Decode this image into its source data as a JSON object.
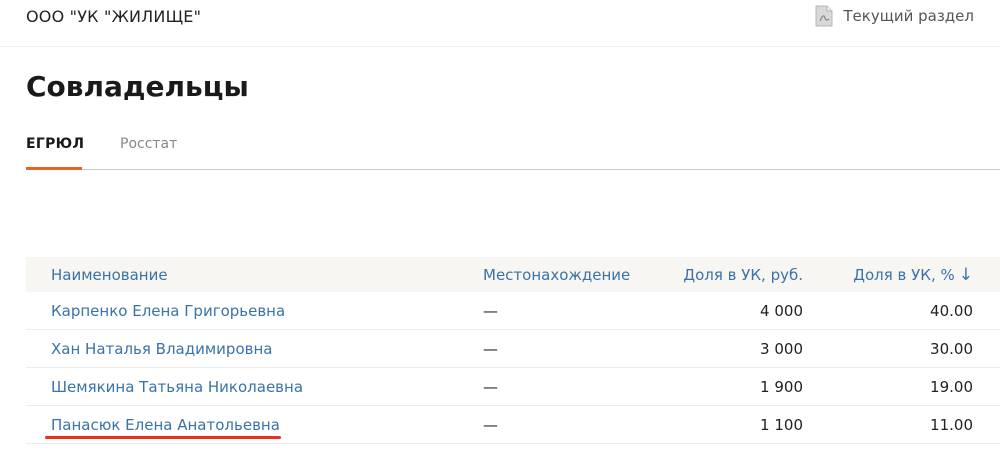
{
  "header": {
    "company": "ООО \"УК \"ЖИЛИЩЕ\"",
    "section_link": "Текущий раздел",
    "section_icon": "pdf-file-icon"
  },
  "page": {
    "title": "Совладельцы"
  },
  "tabs": [
    {
      "label": "ЕГРЮЛ",
      "active": true
    },
    {
      "label": "Росстат",
      "active": false
    }
  ],
  "table": {
    "headers": {
      "name": "Наименование",
      "location": "Местонахождение",
      "share_rub": "Доля в УК, руб.",
      "share_pct": "Доля в УК, %",
      "sort_icon": "arrow-down-icon"
    },
    "rows": [
      {
        "name": "Карпенко Елена Григорьевна",
        "location": "—",
        "share_rub": "4 000",
        "share_pct": "40.00"
      },
      {
        "name": "Хан Наталья Владимировна",
        "location": "—",
        "share_rub": "3 000",
        "share_pct": "30.00"
      },
      {
        "name": "Шемякина Татьяна Николаевна",
        "location": "—",
        "share_rub": "1 900",
        "share_pct": "19.00"
      },
      {
        "name": "Панасюк Елена Анатольевна",
        "location": "—",
        "share_rub": "1 100",
        "share_pct": "11.00"
      }
    ]
  },
  "colors": {
    "accent": "#e8641e",
    "link": "#3a73a8",
    "highlight_underline": "#e8341e",
    "header_bg": "#f7f6f2"
  }
}
